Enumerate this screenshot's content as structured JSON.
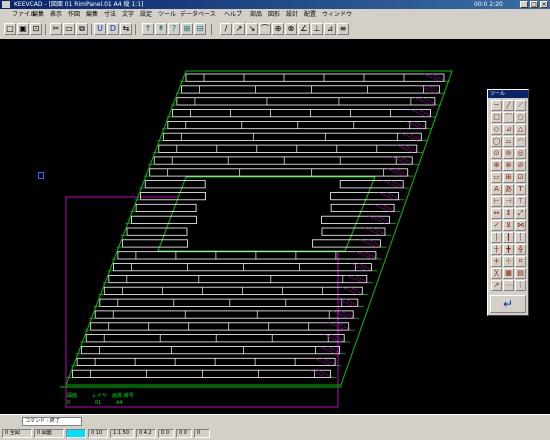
{
  "titlebar": {
    "title": "KEEVCAD - [図面 01 RimPanel.01 A4 縦 1:1]",
    "clock": "00:0 2:20",
    "buttons": [
      "_",
      "□",
      "×"
    ]
  },
  "menu": [
    "ファイル",
    "編集",
    "表示",
    "作図",
    "編集",
    "寸法",
    "文字",
    "設定",
    "ツール",
    "データベース",
    "ヘルプ",
    "部品",
    "図形",
    "設計",
    "配置",
    "ウィンドウ"
  ],
  "toolbar": {
    "buttons": [
      "□",
      "▣",
      "⊡",
      "✂",
      "▭",
      "⧉",
      "U",
      "D",
      "⇆",
      "↑",
      "↟",
      "?",
      "⊞",
      "⊟",
      "/",
      "↗",
      "↘",
      "⌒",
      "⊕",
      "⊗",
      "∠",
      "⊥",
      "⊿",
      "≡"
    ]
  },
  "drawing": {
    "info_labels": [
      "図面",
      "レイヤ",
      "画層 番号",
      "0",
      "01",
      "A4"
    ]
  },
  "palette": {
    "title": "ツール",
    "tools": [
      "─",
      "╱",
      "⟋",
      "□",
      "⌒",
      "○",
      "◇",
      "⊿",
      "△",
      "◯",
      "⌓",
      "◠",
      "⊙",
      "⊚",
      "◎",
      "⊕",
      "⊗",
      "⊘",
      "▭",
      "⊞",
      "⊡",
      "A",
      "あ",
      "T",
      "⊢",
      "⊣",
      "⊤",
      "↔",
      "↕",
      "⤢",
      "✓",
      "⊻",
      "⋈",
      "│",
      "┃",
      "┆",
      "┼",
      "╋",
      "╬",
      "+",
      "⊹",
      "⌗",
      "╳",
      "▦",
      "▤",
      "↗",
      "⋯",
      "⋮"
    ],
    "enter": "↵"
  },
  "cmdline": {
    "value": "コマンド : 終了"
  },
  "status": [
    "0 全図",
    "0 図面",
    "",
    "0 10",
    "1:1 50",
    "0 4.2",
    "0 0",
    "0 0",
    "0"
  ]
}
